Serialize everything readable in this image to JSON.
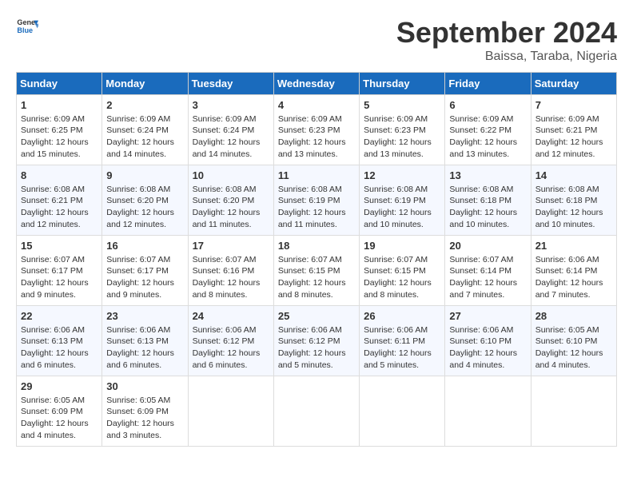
{
  "logo": {
    "line1": "General",
    "line2": "Blue"
  },
  "title": "September 2024",
  "subtitle": "Baissa, Taraba, Nigeria",
  "days_header": [
    "Sunday",
    "Monday",
    "Tuesday",
    "Wednesday",
    "Thursday",
    "Friday",
    "Saturday"
  ],
  "weeks": [
    [
      {
        "day": "1",
        "sunrise": "6:09 AM",
        "sunset": "6:25 PM",
        "daylight": "12 hours and 15 minutes."
      },
      {
        "day": "2",
        "sunrise": "6:09 AM",
        "sunset": "6:24 PM",
        "daylight": "12 hours and 14 minutes."
      },
      {
        "day": "3",
        "sunrise": "6:09 AM",
        "sunset": "6:24 PM",
        "daylight": "12 hours and 14 minutes."
      },
      {
        "day": "4",
        "sunrise": "6:09 AM",
        "sunset": "6:23 PM",
        "daylight": "12 hours and 13 minutes."
      },
      {
        "day": "5",
        "sunrise": "6:09 AM",
        "sunset": "6:23 PM",
        "daylight": "12 hours and 13 minutes."
      },
      {
        "day": "6",
        "sunrise": "6:09 AM",
        "sunset": "6:22 PM",
        "daylight": "12 hours and 13 minutes."
      },
      {
        "day": "7",
        "sunrise": "6:09 AM",
        "sunset": "6:21 PM",
        "daylight": "12 hours and 12 minutes."
      }
    ],
    [
      {
        "day": "8",
        "sunrise": "6:08 AM",
        "sunset": "6:21 PM",
        "daylight": "12 hours and 12 minutes."
      },
      {
        "day": "9",
        "sunrise": "6:08 AM",
        "sunset": "6:20 PM",
        "daylight": "12 hours and 12 minutes."
      },
      {
        "day": "10",
        "sunrise": "6:08 AM",
        "sunset": "6:20 PM",
        "daylight": "12 hours and 11 minutes."
      },
      {
        "day": "11",
        "sunrise": "6:08 AM",
        "sunset": "6:19 PM",
        "daylight": "12 hours and 11 minutes."
      },
      {
        "day": "12",
        "sunrise": "6:08 AM",
        "sunset": "6:19 PM",
        "daylight": "12 hours and 10 minutes."
      },
      {
        "day": "13",
        "sunrise": "6:08 AM",
        "sunset": "6:18 PM",
        "daylight": "12 hours and 10 minutes."
      },
      {
        "day": "14",
        "sunrise": "6:08 AM",
        "sunset": "6:18 PM",
        "daylight": "12 hours and 10 minutes."
      }
    ],
    [
      {
        "day": "15",
        "sunrise": "6:07 AM",
        "sunset": "6:17 PM",
        "daylight": "12 hours and 9 minutes."
      },
      {
        "day": "16",
        "sunrise": "6:07 AM",
        "sunset": "6:17 PM",
        "daylight": "12 hours and 9 minutes."
      },
      {
        "day": "17",
        "sunrise": "6:07 AM",
        "sunset": "6:16 PM",
        "daylight": "12 hours and 8 minutes."
      },
      {
        "day": "18",
        "sunrise": "6:07 AM",
        "sunset": "6:15 PM",
        "daylight": "12 hours and 8 minutes."
      },
      {
        "day": "19",
        "sunrise": "6:07 AM",
        "sunset": "6:15 PM",
        "daylight": "12 hours and 8 minutes."
      },
      {
        "day": "20",
        "sunrise": "6:07 AM",
        "sunset": "6:14 PM",
        "daylight": "12 hours and 7 minutes."
      },
      {
        "day": "21",
        "sunrise": "6:06 AM",
        "sunset": "6:14 PM",
        "daylight": "12 hours and 7 minutes."
      }
    ],
    [
      {
        "day": "22",
        "sunrise": "6:06 AM",
        "sunset": "6:13 PM",
        "daylight": "12 hours and 6 minutes."
      },
      {
        "day": "23",
        "sunrise": "6:06 AM",
        "sunset": "6:13 PM",
        "daylight": "12 hours and 6 minutes."
      },
      {
        "day": "24",
        "sunrise": "6:06 AM",
        "sunset": "6:12 PM",
        "daylight": "12 hours and 6 minutes."
      },
      {
        "day": "25",
        "sunrise": "6:06 AM",
        "sunset": "6:12 PM",
        "daylight": "12 hours and 5 minutes."
      },
      {
        "day": "26",
        "sunrise": "6:06 AM",
        "sunset": "6:11 PM",
        "daylight": "12 hours and 5 minutes."
      },
      {
        "day": "27",
        "sunrise": "6:06 AM",
        "sunset": "6:10 PM",
        "daylight": "12 hours and 4 minutes."
      },
      {
        "day": "28",
        "sunrise": "6:05 AM",
        "sunset": "6:10 PM",
        "daylight": "12 hours and 4 minutes."
      }
    ],
    [
      {
        "day": "29",
        "sunrise": "6:05 AM",
        "sunset": "6:09 PM",
        "daylight": "12 hours and 4 minutes."
      },
      {
        "day": "30",
        "sunrise": "6:05 AM",
        "sunset": "6:09 PM",
        "daylight": "12 hours and 3 minutes."
      },
      null,
      null,
      null,
      null,
      null
    ]
  ],
  "labels": {
    "sunrise": "Sunrise:",
    "sunset": "Sunset:",
    "daylight": "Daylight:"
  }
}
